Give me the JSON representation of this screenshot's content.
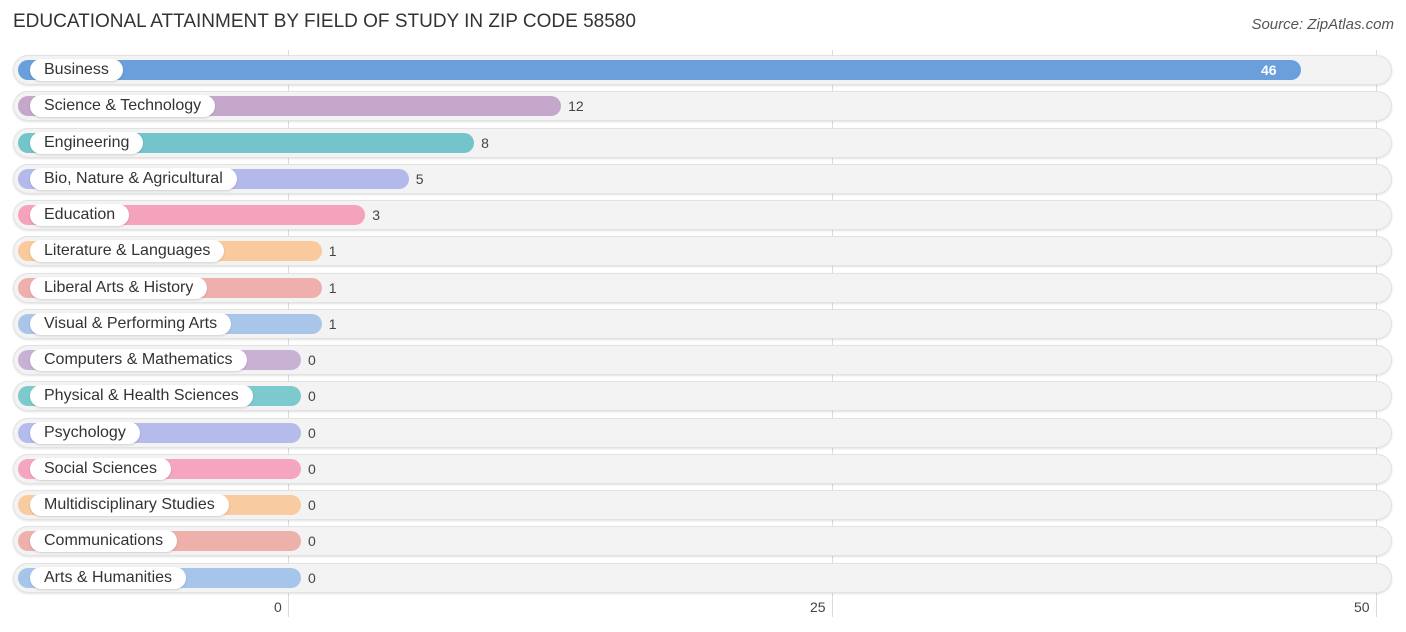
{
  "header": {
    "title": "EDUCATIONAL ATTAINMENT BY FIELD OF STUDY IN ZIP CODE 58580",
    "source": "Source: ZipAtlas.com"
  },
  "chart_data": {
    "type": "bar",
    "orientation": "horizontal",
    "title": "EDUCATIONAL ATTAINMENT BY FIELD OF STUDY IN ZIP CODE 58580",
    "xlabel": "",
    "ylabel": "",
    "xlim": [
      0,
      50
    ],
    "xticks": [
      "0",
      "25",
      "50"
    ],
    "grid": true,
    "categories": [
      "Business",
      "Science & Technology",
      "Engineering",
      "Bio, Nature & Agricultural",
      "Education",
      "Literature & Languages",
      "Liberal Arts & History",
      "Visual & Performing Arts",
      "Computers & Mathematics",
      "Physical & Health Sciences",
      "Psychology",
      "Social Sciences",
      "Multidisciplinary Studies",
      "Communications",
      "Arts & Humanities"
    ],
    "values": [
      46,
      12,
      8,
      5,
      3,
      1,
      1,
      1,
      0,
      0,
      0,
      0,
      0,
      0,
      0
    ],
    "value_labels": [
      "46",
      "12",
      "8",
      "5",
      "3",
      "1",
      "1",
      "1",
      "0",
      "0",
      "0",
      "0",
      "0",
      "0",
      "0"
    ],
    "colors": [
      "#6a9fdc",
      "#c6a7cc",
      "#74c4cc",
      "#b3b9ea",
      "#f5a3bd",
      "#fac99d",
      "#eeafad",
      "#a9c6ea",
      "#c9b1d3",
      "#7ccacd",
      "#b5bbeb",
      "#f5a5c0",
      "#f9cba0",
      "#eeb0ab",
      "#a7c5eb"
    ]
  }
}
